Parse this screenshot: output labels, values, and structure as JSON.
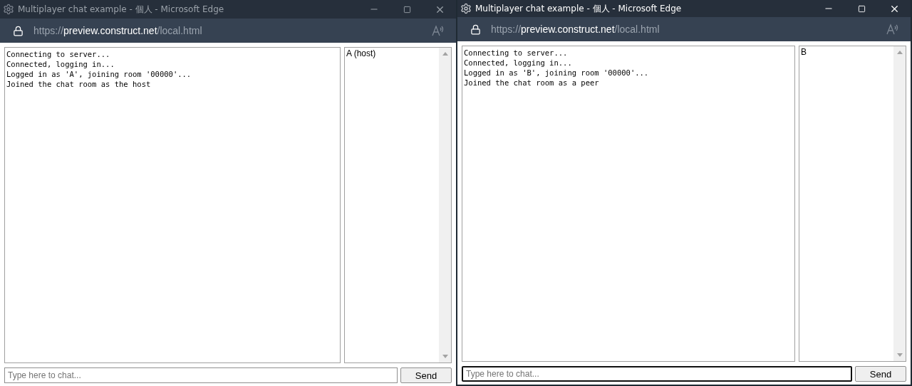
{
  "windows": [
    {
      "title": "Multiplayer chat example - 個人 - Microsoft Edge",
      "active": false,
      "url": {
        "scheme": "https://",
        "host": "preview.construct.net",
        "path": "/local.html"
      },
      "log": [
        "Connecting to server...",
        "Connected, logging in...",
        "Logged in as 'A', joining room '00000'...",
        "Joined the chat room as the host"
      ],
      "users": [
        "A (host)"
      ],
      "chat": {
        "placeholder": "Type here to chat...",
        "focused": false
      },
      "send": "Send"
    },
    {
      "title": "Multiplayer chat example - 個人 - Microsoft Edge",
      "active": true,
      "url": {
        "scheme": "https://",
        "host": "preview.construct.net",
        "path": "/local.html"
      },
      "log": [
        "Connecting to server...",
        "Connected, logging in...",
        "Logged in as 'B', joining room '00000'...",
        "Joined the chat room as a peer"
      ],
      "users": [
        "B"
      ],
      "chat": {
        "placeholder": "Type here to chat...",
        "focused": true
      },
      "send": "Send"
    }
  ]
}
